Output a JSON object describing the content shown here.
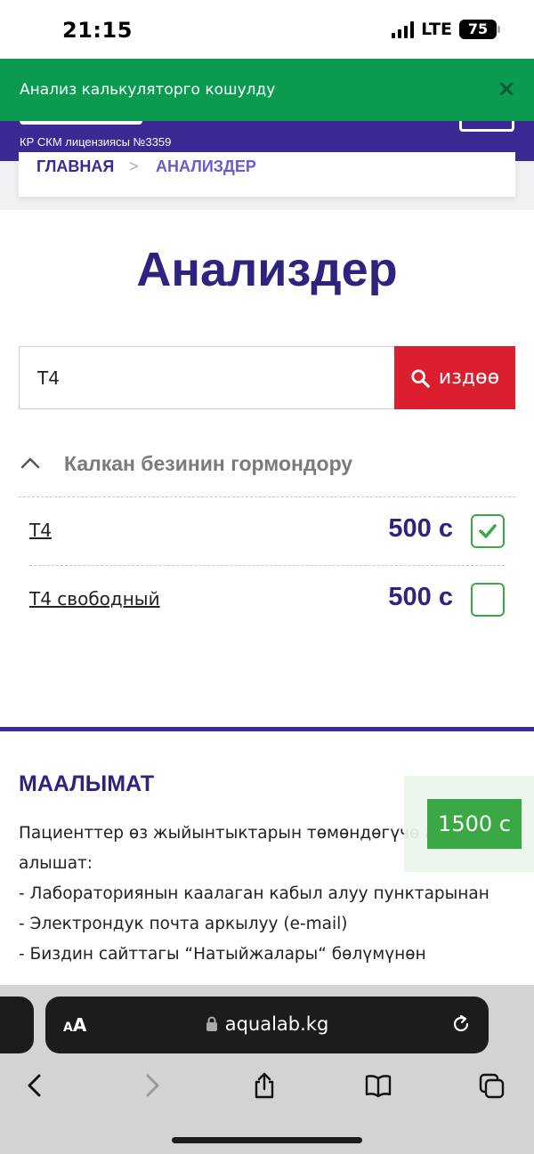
{
  "status_bar": {
    "time": "21:15",
    "network": "LTE",
    "battery": "75"
  },
  "toast": {
    "message": "Анализ калькуляторго кошулду",
    "close_symbol": "×"
  },
  "header": {
    "license": "КР СКМ лицензиясы №3359"
  },
  "breadcrumb": {
    "home": "ГЛАВНАЯ",
    "separator": ">",
    "current": "АНАЛИЗДЕР"
  },
  "page": {
    "title": "Анализдер"
  },
  "search": {
    "value": "T4",
    "button_label": "издөө"
  },
  "category": {
    "title": "Калкан безинин гормондору",
    "tests": [
      {
        "name": "T4",
        "price": "500 с",
        "checked": true
      },
      {
        "name": "T4 свободный",
        "price": "500 с",
        "checked": false
      }
    ]
  },
  "info": {
    "title": "МААЛЫМАТ",
    "line1": "Пациенттер өз жыйынтыктарын төмөндөгүчө а",
    "line2": "алышат:",
    "line3": "- Лабораториянын каалаган кабыл алуу пунктарынан",
    "line4": "- Электрондук почта аркылуу (e-mail)",
    "line5": "- Биздин сайттагы “Натыйжалары“ бөлүмүнөн"
  },
  "total": {
    "amount": "1500 с"
  },
  "browser": {
    "aa_large": "A",
    "aa_small": "A",
    "url": "aqualab.kg"
  },
  "colors": {
    "brand": "#3b2a94",
    "title": "#2d2480",
    "toast": "#0b9b50",
    "search_button": "#dc1f2f",
    "check": "#3aa845"
  }
}
